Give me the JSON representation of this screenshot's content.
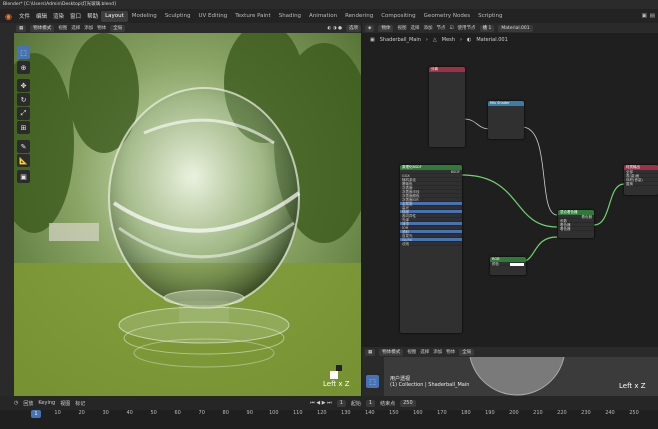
{
  "window": {
    "title": "Blender* [C:\\Users\\Admin\\Desktop\\灯光玻璃.blend]"
  },
  "menu": {
    "items": [
      "文件",
      "编辑",
      "渲染",
      "窗口",
      "帮助"
    ],
    "workspaces": [
      "Layout",
      "Modeling",
      "Sculpting",
      "UV Editing",
      "Texture Paint",
      "Shading",
      "Animation",
      "Rendering",
      "Compositing",
      "Geometry Nodes",
      "Scripting"
    ],
    "active_workspace": "Layout"
  },
  "viewport": {
    "mode": "物体模式",
    "menus": [
      "视图",
      "选择",
      "添加",
      "物体"
    ],
    "transform": "全局",
    "options_label": "选项",
    "view_label": "Left x Z"
  },
  "tools": [
    "select-box-icon",
    "cursor-icon",
    "move-icon",
    "rotate-icon",
    "scale-icon",
    "transform-icon",
    "annotate-icon",
    "measure-icon",
    "add-cube-icon"
  ],
  "node_editor": {
    "header": {
      "type": "物体",
      "menus": [
        "视图",
        "选择",
        "添加",
        "节点"
      ],
      "use_nodes": "使用节点",
      "slot": "槽 1",
      "material": "Material.001"
    },
    "breadcrumb": [
      "Shaderball_Main",
      "Mesh",
      "Material.001"
    ],
    "nodes": {
      "frame_title": "分离",
      "frame2_title": "Mix Shader",
      "bsdf_title": "原理化BSDF",
      "bsdf_out": "BSDF",
      "ggx": "GGX",
      "random_walk": "随机游走",
      "input1": "基础色",
      "input2": "次表面",
      "input3": "次表面半径",
      "input4": "次表面颜色",
      "input5": "次表面IOR",
      "input6": "金属度",
      "input7": "高光",
      "input8": "糙度",
      "input9": "各向异性",
      "input10": "光泽",
      "input11": "清漆",
      "input12": "IOR",
      "input13": "透射",
      "input14": "自发光",
      "input15": "Alpha",
      "input16": "法线",
      "mix_title": "混合着色器",
      "mix_fac": "系数",
      "mix_shader1": "着色器",
      "mix_shader2": "着色器",
      "mix_out": "着色器",
      "small_title": "RGB",
      "small_row": "颜色",
      "out_title": "材质输出",
      "out_row1": "全部",
      "out_row2": "表(曲)面",
      "out_row3": "体积(音量)",
      "out_row4": "置换"
    }
  },
  "ne_bottom": {
    "mode": "物体模式",
    "menus": [
      "视图",
      "选择",
      "添加",
      "物体"
    ],
    "transform": "全局",
    "view_name": "用户透视",
    "collection": "(1) Collection | Shaderball_Main",
    "view_label": "Left x Z"
  },
  "timeline": {
    "menus": [
      "回放",
      "Keying",
      "视图",
      "标记"
    ],
    "current_frame": "1",
    "start_label": "起始",
    "start": "1",
    "end_label": "结束点",
    "end": "250",
    "ticks": [
      "1",
      "10",
      "20",
      "30",
      "40",
      "50",
      "60",
      "70",
      "80",
      "90",
      "100",
      "110",
      "120",
      "130",
      "140",
      "150",
      "160",
      "170",
      "180",
      "190",
      "200",
      "210",
      "220",
      "230",
      "240",
      "250"
    ]
  }
}
